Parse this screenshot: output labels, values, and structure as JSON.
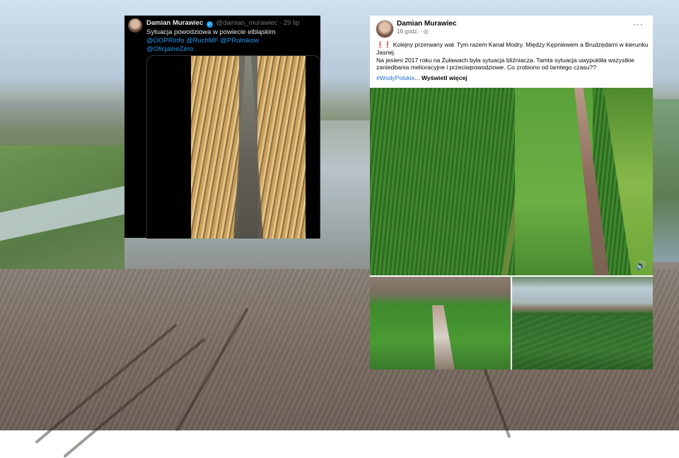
{
  "tweet": {
    "author_name": "Damian Murawiec",
    "handle": "@damian_murawiec",
    "time": "· 29 lip",
    "text": "Sytuacja powodziowa w powiecie elbląskim",
    "mentions_line1": "@OOPRInfo @RuchMF @PRolnikow",
    "mentions_line2": "@OficjalneZero",
    "verified_icon": "verified-badge-icon",
    "verified_color": "#1d9bf0",
    "background": "#000000"
  },
  "facebook": {
    "author_name": "Damian Murawiec",
    "time": "16 godz. ·",
    "globe_icon": "globe-icon",
    "more_label": "···",
    "exclamation": "❗❗",
    "text_line1": "Kolejny przerwany wał. Tym razem Kanał Modry. Między Kępniewem a Brudzędami w kierunku Jasnej.",
    "text_line2": "Na jesieni 2017 roku na Żuławach była sytuacja bliźniacza. Tamta sytuacja uwypukliła wszystkie zaniedbania melioracyjne i przeciwpowodziowe. Co zrobiono od tamtego czasu??",
    "hashtag": "#WodyPolskie",
    "ellipsis": "...",
    "see_more": "Wyświetl więcej",
    "volume_icon": "volume-icon",
    "hashtag_color": "#216fdb"
  }
}
